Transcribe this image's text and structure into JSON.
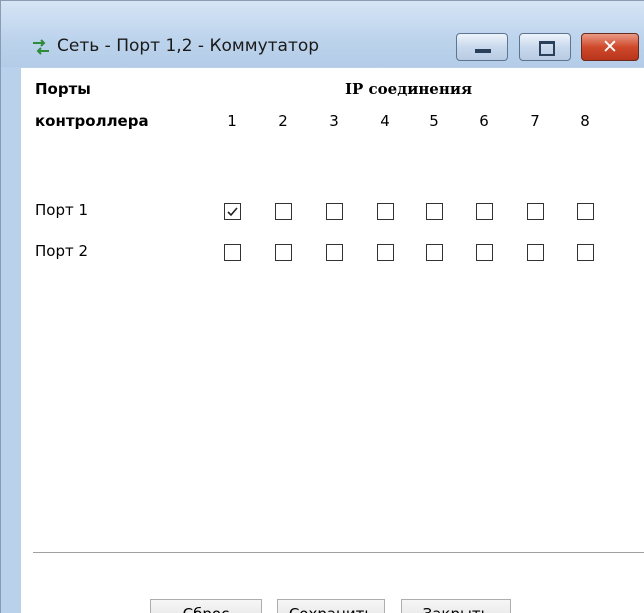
{
  "window": {
    "title": "Сеть - Порт 1,2 - Коммутатор",
    "icon": "network-switch-icon",
    "controls": [
      "minimize-icon",
      "maximize-icon",
      "close-icon"
    ],
    "close_glyph": "✕"
  },
  "header": {
    "ports_line1": "Порты",
    "ports_line2": "контроллера",
    "ip_connections": "IP соединения"
  },
  "columns": [
    "1",
    "2",
    "3",
    "4",
    "5",
    "6",
    "7",
    "8"
  ],
  "rows": [
    {
      "label": "Порт 1",
      "checked": [
        true,
        false,
        false,
        false,
        false,
        false,
        false,
        false
      ]
    },
    {
      "label": "Порт 2",
      "checked": [
        false,
        false,
        false,
        false,
        false,
        false,
        false,
        false
      ]
    }
  ],
  "buttons": {
    "reset": "Сброс",
    "save": "Сохранить",
    "close": "Закрыть"
  },
  "colors": {
    "title_bar": "#bcd3ec",
    "close_button": "#cf4a2c"
  }
}
